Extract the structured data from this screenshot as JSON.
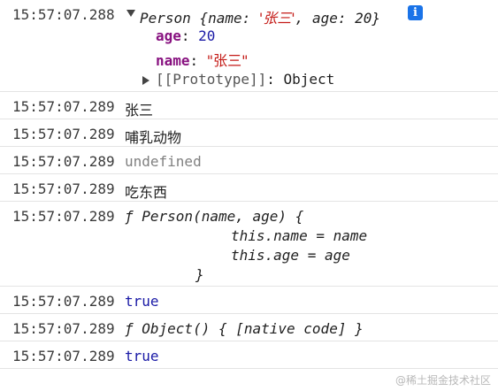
{
  "rows": [
    {
      "timestamp": "15:57:07.288",
      "object_summary": {
        "ctor": "Person",
        "open": " {",
        "k1": "name",
        "sep1": ": ",
        "v1": "'张三'",
        "comma": ", ",
        "k2": "age",
        "sep2": ": ",
        "v2": "20",
        "close": "}"
      },
      "info_glyph": "i",
      "props": [
        {
          "key": "age",
          "colon": ": ",
          "value": "20"
        },
        {
          "key": "name",
          "colon": ": ",
          "value": "\"张三\""
        }
      ],
      "prototype": {
        "key": "[[Prototype]]",
        "colon": ": ",
        "value": "Object"
      }
    },
    {
      "timestamp": "15:57:07.289",
      "text": "张三"
    },
    {
      "timestamp": "15:57:07.289",
      "text": "哺乳动物"
    },
    {
      "timestamp": "15:57:07.289",
      "text": "undefined"
    },
    {
      "timestamp": "15:57:07.289",
      "text": "吃东西"
    },
    {
      "timestamp": "15:57:07.289",
      "fn_lines": [
        "ƒ Person(name, age) {",
        "this.name = name",
        "this.age = age",
        "}"
      ]
    },
    {
      "timestamp": "15:57:07.289",
      "text": "true"
    },
    {
      "timestamp": "15:57:07.289",
      "text": "ƒ Object() { [native code] }"
    },
    {
      "timestamp": "15:57:07.289",
      "text": "true"
    }
  ],
  "watermark": "@稀土掘金技术社区"
}
